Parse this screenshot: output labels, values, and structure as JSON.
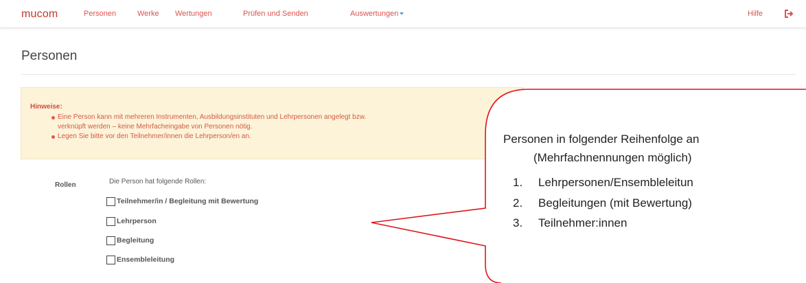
{
  "nav": {
    "brand": "mucom",
    "links": [
      "Personen",
      "Werke",
      "Wertungen",
      "Prüfen und Senden",
      "Auswertungen"
    ],
    "help": "Hilfe",
    "logout_icon": "logout-icon",
    "accent_color": "#d9534f"
  },
  "page": {
    "title": "Personen"
  },
  "hint": {
    "title": "Hinweise:",
    "items": [
      "Eine Person kann mit mehreren Instrumenten, Ausbildungsinstituten und Lehrpersonen angelegt bzw.",
      "verknüpft werden – keine Mehrfacheingabe von Personen nötig.",
      "Legen Sie bitte vor den Teilnehmer/innen die Lehrperson/en an."
    ]
  },
  "roles": {
    "label": "Rollen",
    "intro": "Die Person hat folgende Rollen:",
    "options": [
      {
        "label": "Teilnehmer/in / Begleitung mit Bewertung",
        "checked": false
      },
      {
        "label": "Lehrperson",
        "checked": false
      },
      {
        "label": "Begleitung",
        "checked": false
      },
      {
        "label": "Ensembleleitung",
        "checked": false
      }
    ]
  },
  "callout": {
    "line1": "Personen in folgender Reihenfolge an",
    "line2": "(Mehrfachnennungen möglich)",
    "items": [
      {
        "num": "1.",
        "text": "Lehrpersonen/Ensembleleitun"
      },
      {
        "num": "2.",
        "text": "Begleitungen (mit Bewertung)"
      },
      {
        "num": "3.",
        "text": "Teilnehmer:innen"
      }
    ],
    "border_color": "#e0141b"
  }
}
